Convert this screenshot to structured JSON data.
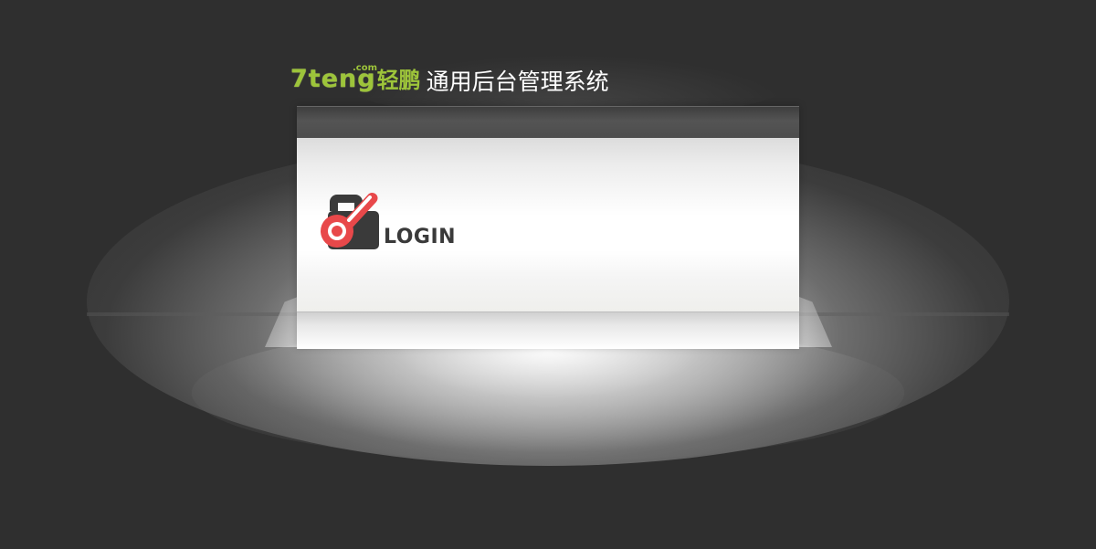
{
  "header": {
    "logo_text": "7teng",
    "logo_suffix": ".com",
    "logo_chinese": "轻鹏",
    "system_title": "通用后台管理系统"
  },
  "login_panel": {
    "label": "LOGIN",
    "icon": "lock-key-icon"
  },
  "colors": {
    "background": "#2f2f2f",
    "logo_green": "#9dc43a",
    "lock_red": "#e8484a",
    "lock_dark": "#3a3a3a",
    "title_white": "#ffffff"
  }
}
